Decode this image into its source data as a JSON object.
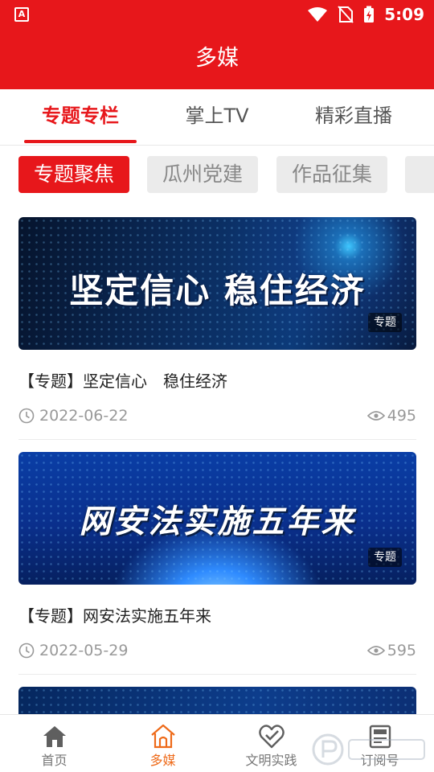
{
  "status_bar": {
    "time": "5:09",
    "app_icon": "A"
  },
  "header": {
    "title": "多媒"
  },
  "main_tabs": [
    {
      "label": "专题专栏",
      "active": true
    },
    {
      "label": "掌上TV",
      "active": false
    },
    {
      "label": "精彩直播",
      "active": false
    }
  ],
  "sub_tabs": [
    {
      "label": "专题聚焦",
      "active": true
    },
    {
      "label": "瓜州党建",
      "active": false
    },
    {
      "label": "作品征集",
      "active": false
    }
  ],
  "feed": [
    {
      "banner_text": "坚定信心  稳住经济",
      "tag": "专题",
      "title": "【专题】坚定信心　稳住经济",
      "date": "2022-06-22",
      "views": "495"
    },
    {
      "banner_text": "网安法实施五年来",
      "tag": "专题",
      "title": "【专题】网安法实施五年来",
      "date": "2022-05-29",
      "views": "595"
    }
  ],
  "bottom_nav": [
    {
      "label": "首页",
      "icon": "home-icon",
      "active": false
    },
    {
      "label": "多媒",
      "icon": "media-home-icon",
      "active": true
    },
    {
      "label": "文明实践",
      "icon": "heart-check-icon",
      "active": false
    },
    {
      "label": "订阅号",
      "icon": "subscription-icon",
      "active": false
    }
  ],
  "colors": {
    "brand_red": "#e7171b",
    "active_nav": "#ee6a19",
    "muted_text": "#999999"
  }
}
